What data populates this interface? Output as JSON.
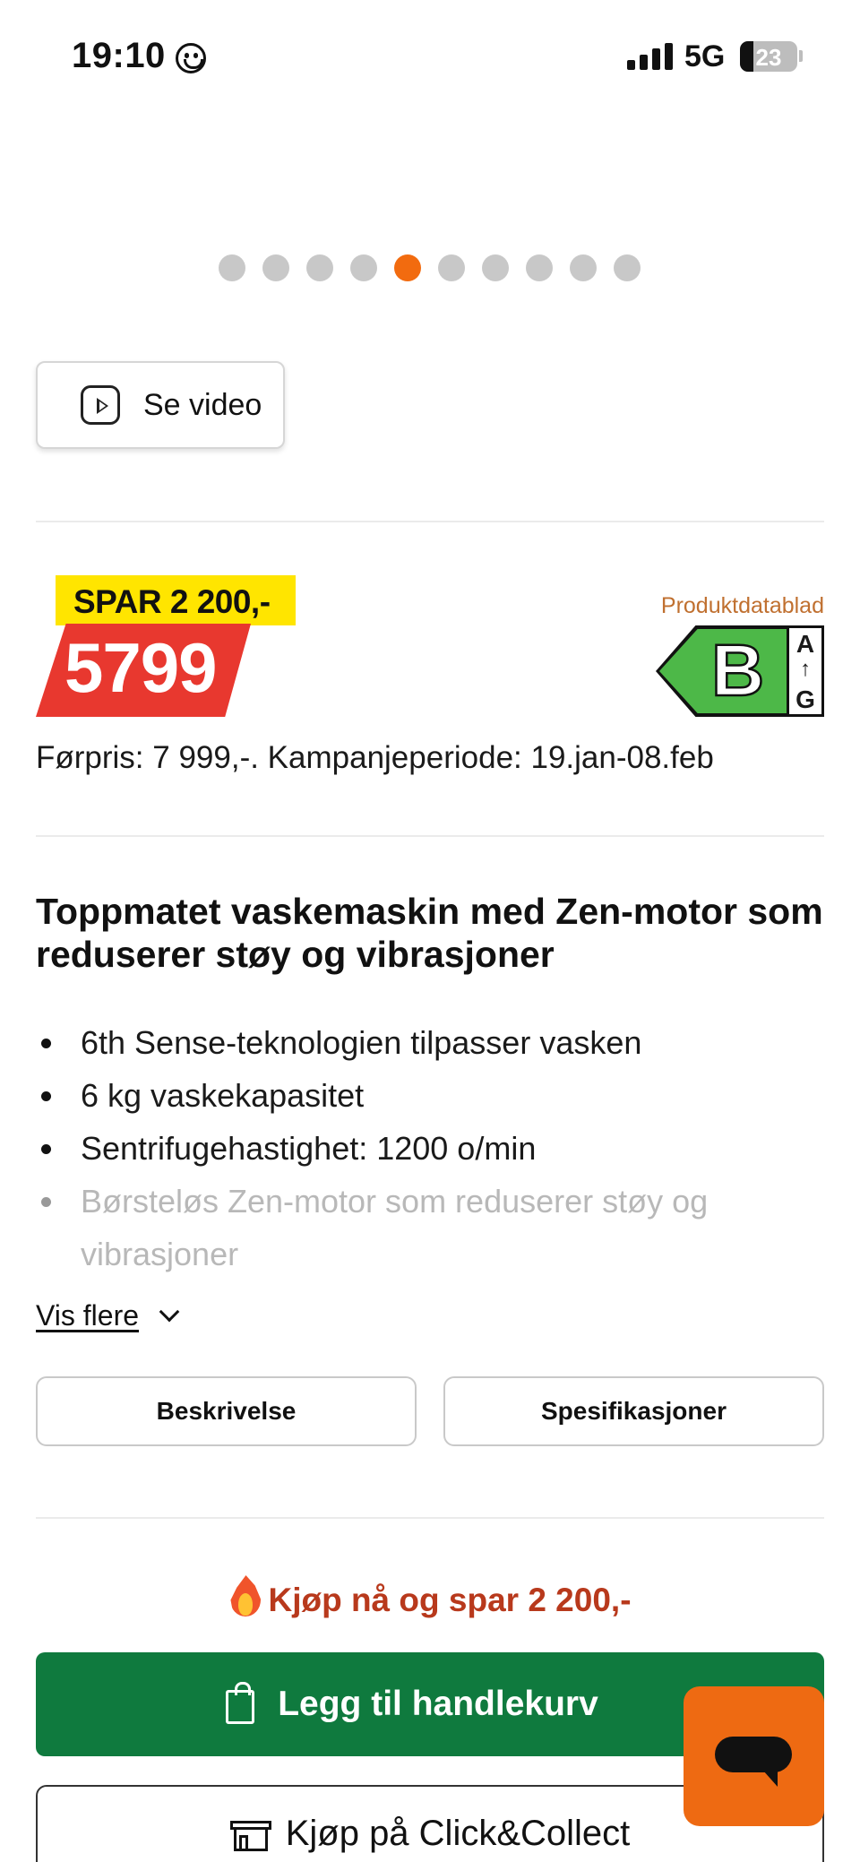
{
  "status_bar": {
    "time": "19:10",
    "network": "5G",
    "battery": "23",
    "battery_level": 0.23
  },
  "carousel": {
    "total": 10,
    "active_index": 4,
    "colors": {
      "active": "#f26b0f",
      "inactive": "#c8c8c8"
    }
  },
  "video_button": {
    "label": "Se video",
    "icon": "play-icon"
  },
  "pricing": {
    "save_badge": "SPAR 2 200,-",
    "price": "5799",
    "datasheet_link": "Produktdatablad",
    "energy_class": {
      "letter": "B",
      "scale_top": "A",
      "scale_arrow": "↑",
      "scale_bottom": "G",
      "color": "#4db848"
    },
    "previous_price": "Førpris: 7 999,-. Kampanjeperiode: 19.jan-08.feb"
  },
  "product": {
    "title": "Toppmatet vaskemaskin med Zen-motor som reduserer støy og vibrasjoner",
    "features": [
      "6th Sense-teknologien tilpasser vasken",
      "6 kg vaskekapasitet",
      "Sentrifugehastighet: 1200 o/min",
      "Børsteløs Zen-motor som reduserer støy og vibrasjoner"
    ],
    "show_more": "Vis flere"
  },
  "tabs": {
    "description": "Beskrivelse",
    "specifications": "Spesifikasjoner"
  },
  "purchase": {
    "promo": "Kjøp nå og spar 2 200,-",
    "add_to_cart": "Legg til handlekurv",
    "click_collect": "Kjøp på Click&Collect",
    "colors": {
      "cart": "#0f7a3e",
      "promo": "#b8391c",
      "chat": "#ee6a12"
    }
  }
}
